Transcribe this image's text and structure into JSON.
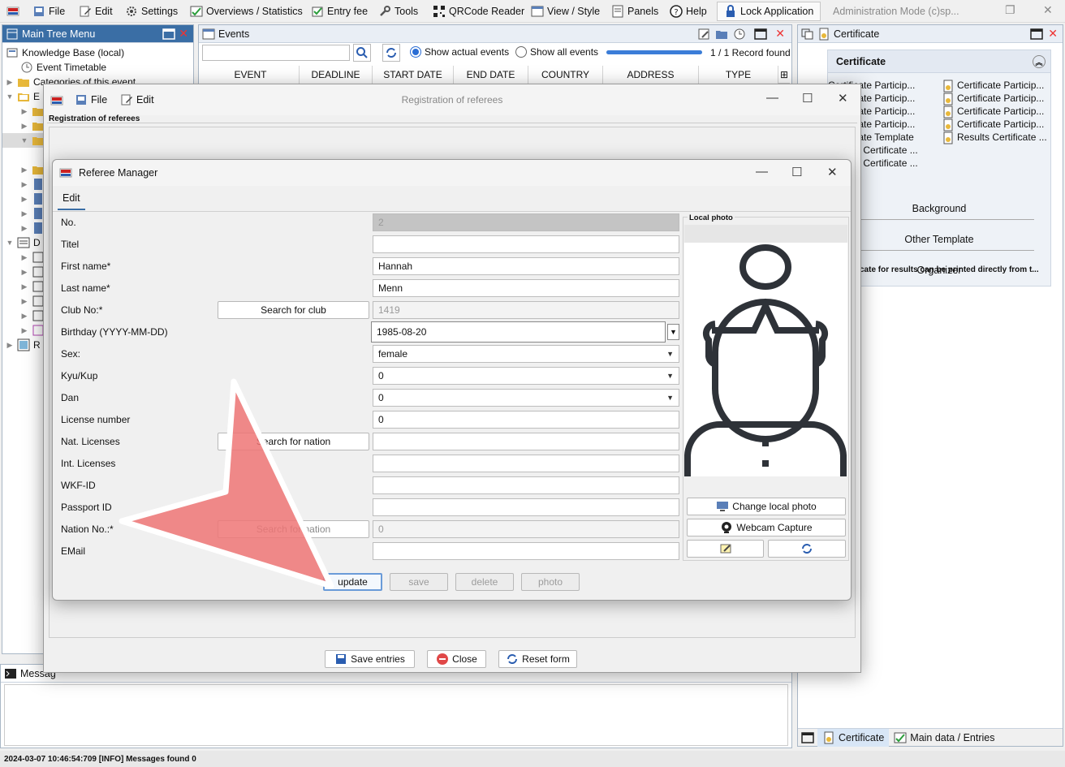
{
  "menubar": {
    "items": [
      "File",
      "Edit",
      "Settings",
      "Overviews / Statistics",
      "Entry fee",
      "Tools",
      "QRCode Reader",
      "View / Style",
      "Panels",
      "Help"
    ],
    "lock_button": "Lock Application",
    "mode_text": "Administration Mode (c)sp..."
  },
  "tree": {
    "title": "Main Tree Menu",
    "items": [
      "Knowledge Base (local)",
      "Event Timetable",
      "Categories of this event",
      "E",
      "D",
      "R"
    ]
  },
  "events": {
    "title": "Events",
    "radio_actual": "Show actual events",
    "radio_all": "Show all events",
    "record_count": "1 / 1 Record found",
    "progress_fraction": 1.0,
    "columns": [
      "EVENT",
      "DEADLINE",
      "START DATE",
      "END DATE",
      "COUNTRY",
      "ADDRESS",
      "TYPE"
    ]
  },
  "certificate": {
    "tab_title": "Certificate",
    "section_title": "Certificate",
    "items_left": [
      "Certificate Particip...",
      "Certificate Particip...",
      "Certificate Particip...",
      "Certificate Particip...",
      "Certificate Template",
      "Results Certificate ...",
      "Results Certificate ..."
    ],
    "items_right": [
      "Certificate Particip...",
      "Certificate Particip...",
      "Certificate Particip...",
      "Certificate Particip...",
      "Results Certificate ..."
    ],
    "groups": [
      "Background",
      "Other Template",
      "Organizer"
    ],
    "note": "cate for results can be printed directly from t...",
    "bottom_tabs": [
      "Certificate",
      "Main data / Entries"
    ]
  },
  "messages": {
    "title": "Messag",
    "status": "2024-03-07 10:46:54:709 [INFO] Messages found 0"
  },
  "registration": {
    "menu_file": "File",
    "menu_edit": "Edit",
    "title": "Registration of referees",
    "header": "Registration of referees",
    "save_entries": "Save entries",
    "close": "Close",
    "reset_form": "Reset form"
  },
  "referee": {
    "title": "Referee Manager",
    "tab": "Edit",
    "photo_label": "Local photo",
    "change_photo": "Change local photo",
    "webcam": "Webcam Capture",
    "search_club": "Search for club",
    "search_nation": "Search for nation",
    "search_nation2": "Search for nation",
    "fields": {
      "no": {
        "label": "No.",
        "value": "2"
      },
      "titel": {
        "label": "Titel",
        "value": ""
      },
      "first_name": {
        "label": "First name*",
        "value": "Hannah"
      },
      "last_name": {
        "label": "Last name*",
        "value": "Menn"
      },
      "club_no": {
        "label": "Club No:*",
        "value": "1419"
      },
      "birthday": {
        "label": "Birthday (YYYY-MM-DD)",
        "value": "1985-08-20"
      },
      "sex": {
        "label": "Sex:",
        "value": "female"
      },
      "kyu": {
        "label": "Kyu/Kup",
        "value": "0"
      },
      "dan": {
        "label": "Dan",
        "value": "0"
      },
      "license": {
        "label": "License number",
        "value": "0"
      },
      "nat_licenses": {
        "label": "Nat. Licenses",
        "value": ""
      },
      "int_licenses": {
        "label": "Int. Licenses",
        "value": ""
      },
      "wkf_id": {
        "label": "WKF-ID",
        "value": ""
      },
      "passport": {
        "label": "Passport ID",
        "value": ""
      },
      "nation_no": {
        "label": "Nation No.:*",
        "value": "0"
      },
      "email": {
        "label": "EMail",
        "value": ""
      }
    },
    "buttons": {
      "update": "update",
      "save": "save",
      "delete": "delete",
      "photo": "photo"
    }
  },
  "colors": {
    "accent": "#3a6ea5",
    "progress": "#3b7dd8",
    "arrow": "#ee7070"
  }
}
